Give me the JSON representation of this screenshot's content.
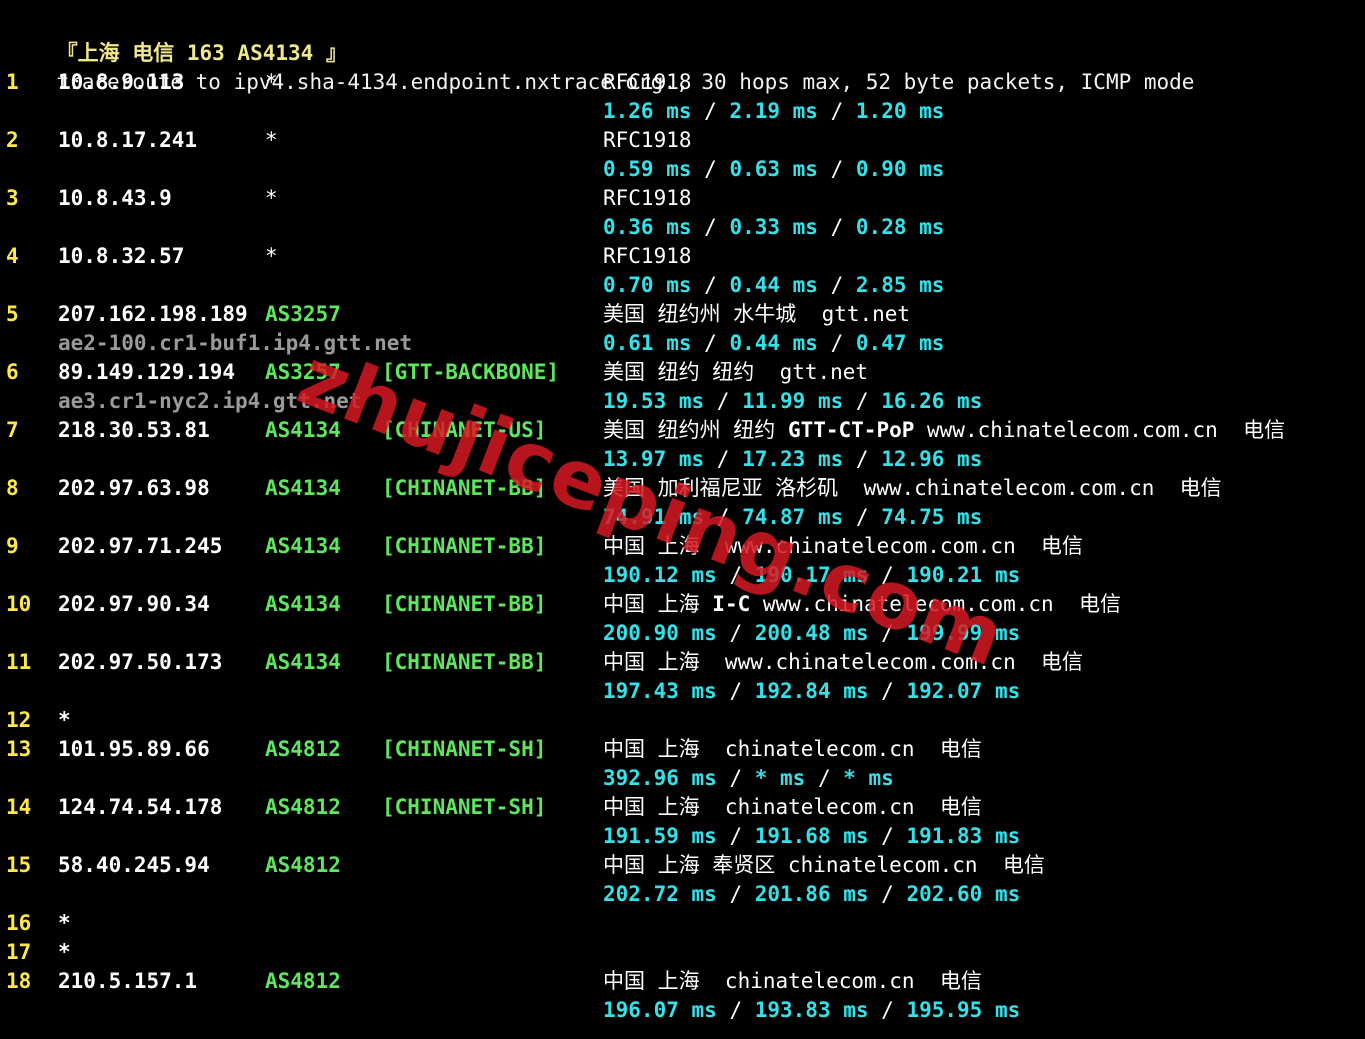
{
  "header": "『上海 电信 163 AS4134 』",
  "command": "traceroute to ipv4.sha-4134.endpoint.nxtrace.org., 30 hops max, 52 byte packets, ICMP mode",
  "watermark": "zhujiceping.com",
  "colors": {
    "background": "#000000",
    "hop_number": "#ffe84a",
    "ip": "#ffffff",
    "asn": "#5ee65e",
    "rtt": "#35e0e8",
    "hostname": "#9a9a9a",
    "watermark": "#d71923"
  },
  "hops": [
    {
      "num": "1",
      "ip": "10.8.9.113",
      "asn": "*",
      "tag": "",
      "geo": "RFC1918",
      "rtt": [
        "1.26 ms",
        "2.19 ms",
        "1.20 ms"
      ],
      "host": ""
    },
    {
      "num": "2",
      "ip": "10.8.17.241",
      "asn": "*",
      "tag": "",
      "geo": "RFC1918",
      "rtt": [
        "0.59 ms",
        "0.63 ms",
        "0.90 ms"
      ],
      "host": ""
    },
    {
      "num": "3",
      "ip": "10.8.43.9",
      "asn": "*",
      "tag": "",
      "geo": "RFC1918",
      "rtt": [
        "0.36 ms",
        "0.33 ms",
        "0.28 ms"
      ],
      "host": ""
    },
    {
      "num": "4",
      "ip": "10.8.32.57",
      "asn": "*",
      "tag": "",
      "geo": "RFC1918",
      "rtt": [
        "0.70 ms",
        "0.44 ms",
        "2.85 ms"
      ],
      "host": ""
    },
    {
      "num": "5",
      "ip": "207.162.198.189",
      "asn": "AS3257",
      "tag": "",
      "geo": "美国 纽约州 水牛城  gtt.net",
      "rtt": [
        "0.61 ms",
        "0.44 ms",
        "0.47 ms"
      ],
      "host": "ae2-100.cr1-buf1.ip4.gtt.net"
    },
    {
      "num": "6",
      "ip": "89.149.129.194",
      "asn": "AS3257",
      "tag": "[GTT-BACKBONE]",
      "geo": "美国 纽约 纽约  gtt.net",
      "rtt": [
        "19.53 ms",
        "11.99 ms",
        "16.26 ms"
      ],
      "host": "ae3.cr1-nyc2.ip4.gtt.net"
    },
    {
      "num": "7",
      "ip": "218.30.53.81",
      "asn": "AS4134",
      "tag": "[CHINANET-US]",
      "geo": "美国 纽约州 纽约 ",
      "geo_bold": "GTT-CT-PoP",
      "geo_tail": " www.chinatelecom.com.cn  电信",
      "rtt": [
        "13.97 ms",
        "17.23 ms",
        "12.96 ms"
      ],
      "host": ""
    },
    {
      "num": "8",
      "ip": "202.97.63.98",
      "asn": "AS4134",
      "tag": "[CHINANET-BB]",
      "geo": "美国 加利福尼亚 洛杉矶  www.chinatelecom.com.cn  电信",
      "rtt": [
        "74.91 ms",
        "74.87 ms",
        "74.75 ms"
      ],
      "host": ""
    },
    {
      "num": "9",
      "ip": "202.97.71.245",
      "asn": "AS4134",
      "tag": "[CHINANET-BB]",
      "geo": "中国 上海  www.chinatelecom.com.cn  电信",
      "rtt": [
        "190.12 ms",
        "190.17 ms",
        "190.21 ms"
      ],
      "host": ""
    },
    {
      "num": "10",
      "ip": "202.97.90.34",
      "asn": "AS4134",
      "tag": "[CHINANET-BB]",
      "geo": "中国 上海 ",
      "geo_bold": "I-C",
      "geo_tail": " www.chinatelecom.com.cn  电信",
      "rtt": [
        "200.90 ms",
        "200.48 ms",
        "199.99 ms"
      ],
      "host": ""
    },
    {
      "num": "11",
      "ip": "202.97.50.173",
      "asn": "AS4134",
      "tag": "[CHINANET-BB]",
      "geo": "中国 上海  www.chinatelecom.com.cn  电信",
      "rtt": [
        "197.43 ms",
        "192.84 ms",
        "192.07 ms"
      ],
      "host": ""
    },
    {
      "num": "12",
      "ip": "*",
      "asn": "",
      "tag": "",
      "geo": "",
      "rtt": [],
      "host": ""
    },
    {
      "num": "13",
      "ip": "101.95.89.66",
      "asn": "AS4812",
      "tag": "[CHINANET-SH]",
      "geo": "中国 上海  chinatelecom.cn  电信",
      "rtt": [
        "392.96 ms",
        "* ms",
        "* ms"
      ],
      "host": ""
    },
    {
      "num": "14",
      "ip": "124.74.54.178",
      "asn": "AS4812",
      "tag": "[CHINANET-SH]",
      "geo": "中国 上海  chinatelecom.cn  电信",
      "rtt": [
        "191.59 ms",
        "191.68 ms",
        "191.83 ms"
      ],
      "host": ""
    },
    {
      "num": "15",
      "ip": "58.40.245.94",
      "asn": "AS4812",
      "tag": "",
      "geo": "中国 上海 奉贤区 chinatelecom.cn  电信",
      "rtt": [
        "202.72 ms",
        "201.86 ms",
        "202.60 ms"
      ],
      "host": ""
    },
    {
      "num": "16",
      "ip": "*",
      "asn": "",
      "tag": "",
      "geo": "",
      "rtt": [],
      "host": ""
    },
    {
      "num": "17",
      "ip": "*",
      "asn": "",
      "tag": "",
      "geo": "",
      "rtt": [],
      "host": ""
    },
    {
      "num": "18",
      "ip": "210.5.157.1",
      "asn": "AS4812",
      "tag": "",
      "geo": "中国 上海  chinatelecom.cn  电信",
      "rtt": [
        "196.07 ms",
        "193.83 ms",
        "195.95 ms"
      ],
      "host": ""
    }
  ]
}
